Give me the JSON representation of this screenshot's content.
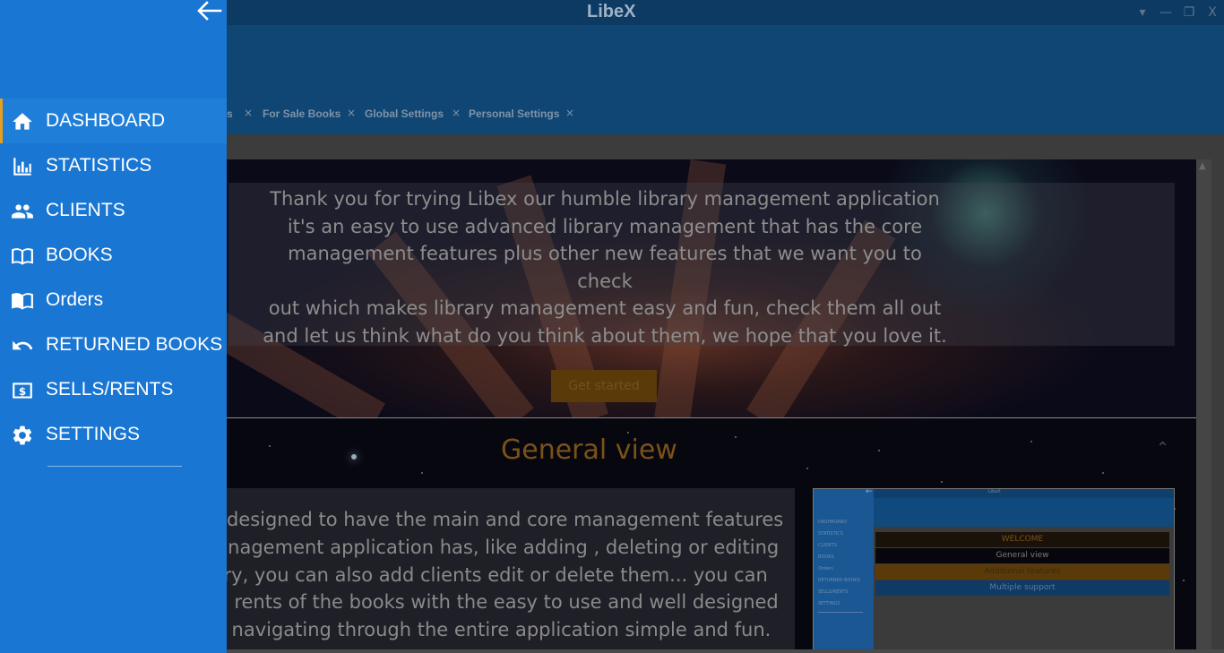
{
  "window": {
    "title": "LibeX",
    "controls": [
      "▾",
      "—",
      "❐",
      "X"
    ]
  },
  "tabs": [
    {
      "label": "s"
    },
    {
      "label": "For Sale Books"
    },
    {
      "label": "Global Settings"
    },
    {
      "label": "Personal Settings"
    }
  ],
  "tab_close": "×",
  "hero": {
    "lines": [
      "Thank you for trying Libex our humble library management application",
      "it's an easy to use advanced library management that has the core",
      "management features plus other new features that we want you to check",
      "out which makes library management easy and fun, check them all out",
      "and let us think what do you think about them, we hope that you love it."
    ],
    "button_label": "Get started"
  },
  "section": {
    "title": "General view",
    "lines": [
      "ly designed to have the main and core management features",
      "nanagement application has, like adding , deleting or editing",
      "rary, you can also add clients edit or delete them... you can",
      "nd rents of the books with the easy to use and well designed",
      "es navigating through the entire application simple and fun."
    ]
  },
  "preview": {
    "app_title": "LibeX",
    "side_items": [
      "DASHBOARD",
      "STATISTICS",
      "CLIENTS",
      "BOOKS",
      "Orders",
      "RETURNED BOOKS",
      "SELLS/RENTS",
      "SETTINGS"
    ],
    "rows": [
      {
        "label": "WELCOME",
        "bg": "#1a1208",
        "fg": "#7a5218"
      },
      {
        "label": "General view",
        "bg": "#06060c",
        "fg": "#7a7a7a"
      },
      {
        "label": "Additional features",
        "bg": "#5a3a08",
        "fg": "#3a2a10"
      },
      {
        "label": "Multiple support",
        "bg": "#0f3a66",
        "fg": "#5a7a9a"
      }
    ]
  },
  "sidebar": {
    "back_icon": "arrow-left-icon",
    "items": [
      {
        "label": "DASHBOARD",
        "icon": "home-icon",
        "active": true
      },
      {
        "label": "STATISTICS",
        "icon": "bar-chart-icon",
        "active": false
      },
      {
        "label": "CLIENTS",
        "icon": "people-icon",
        "active": false
      },
      {
        "label": "BOOKS",
        "icon": "book-open-icon",
        "active": false
      },
      {
        "label": "Orders",
        "icon": "book-icon",
        "active": false
      },
      {
        "label": "RETURNED BOOKS",
        "icon": "undo-icon",
        "active": false
      },
      {
        "label": "SELLS/RENTS",
        "icon": "money-icon",
        "active": false
      },
      {
        "label": "SETTINGS",
        "icon": "gear-icon",
        "active": false
      }
    ]
  },
  "colors": {
    "sidebar_bg": "#1976d2",
    "active_accent": "#e5a021",
    "section_title": "#7a5218",
    "header_bg": "#0f4674"
  }
}
